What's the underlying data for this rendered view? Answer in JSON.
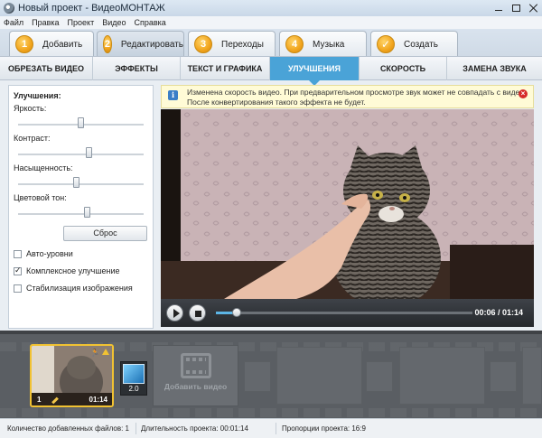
{
  "window": {
    "title": "Новый проект - ВидеоМОНТАЖ"
  },
  "menu": [
    "Файл",
    "Правка",
    "Проект",
    "Видео",
    "Справка"
  ],
  "main_tabs": [
    {
      "num": "1",
      "label": "Добавить"
    },
    {
      "num": "2",
      "label": "Редактировать",
      "active": true
    },
    {
      "num": "3",
      "label": "Переходы"
    },
    {
      "num": "4",
      "label": "Музыка"
    },
    {
      "num": "✓",
      "label": "Создать"
    }
  ],
  "sub_tabs": [
    {
      "label": "ОБРЕЗАТЬ ВИДЕО"
    },
    {
      "label": "ЭФФЕКТЫ"
    },
    {
      "label": "ТЕКСТ И ГРАФИКА"
    },
    {
      "label": "УЛУЧШЕНИЯ",
      "active": true
    },
    {
      "label": "СКОРОСТЬ"
    },
    {
      "label": "ЗАМЕНА ЗВУКА"
    }
  ],
  "enhancements": {
    "title": "Улучшения:",
    "sliders": [
      {
        "label": "Яркость:",
        "value": 0.5
      },
      {
        "label": "Контраст:",
        "value": 0.57
      },
      {
        "label": "Насыщенность:",
        "value": 0.46
      },
      {
        "label": "Цветовой тон:",
        "value": 0.55
      }
    ],
    "reset_label": "Сброс",
    "options": [
      {
        "label": "Авто-уровни",
        "checked": false
      },
      {
        "label": "Комплексное улучшение",
        "checked": true
      },
      {
        "label": "Стабилизация изображения",
        "checked": false
      }
    ]
  },
  "notice": {
    "line1": "Изменена скорость видео. При предварительном просмотре звук может не совпадать с видео.",
    "line2": "После конвертирования такого эффекта не будет."
  },
  "player": {
    "time": "00:06 / 01:14",
    "progress": 0.081
  },
  "timeline": {
    "clip": {
      "number": "1",
      "duration": "01:14"
    },
    "transition": {
      "label": "2.0"
    },
    "add_video_label": "Добавить видео"
  },
  "status": {
    "files": "Количество добавленных файлов: 1",
    "duration": "Длительность проекта: 00:01:14",
    "proportions": "Пропорции проекта: 16:9"
  },
  "colors": {
    "accent": "#4aa3d7",
    "highlight": "#f1c232"
  }
}
